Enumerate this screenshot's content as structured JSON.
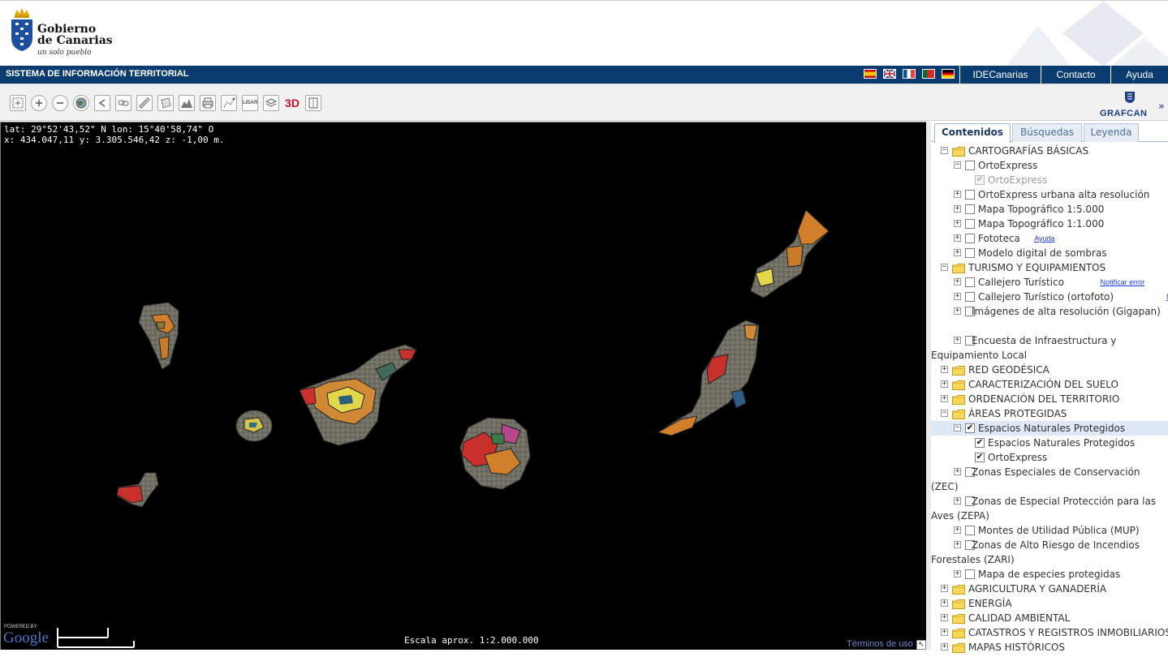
{
  "header": {
    "logo_name_line1": "Gobierno",
    "logo_name_line2": "de Canarias",
    "logo_tagline": "un solo pueblo"
  },
  "navbar": {
    "title": "SISTEMA DE INFORMACIÓN TERRITORIAL",
    "flags": [
      "spanish-flag",
      "english-flag",
      "french-flag",
      "portuguese-flag",
      "german-flag"
    ],
    "links": [
      "IDECanarias",
      "Contacto",
      "Ayuda"
    ]
  },
  "toolbar": {
    "tools": [
      "zoom-box-icon",
      "zoom-in-icon",
      "zoom-out-icon",
      "globe-icon",
      "back-icon",
      "link-icon",
      "ruler-icon",
      "area-measure-icon",
      "profile-icon",
      "print-icon",
      "route-icon",
      "lidar-icon",
      "layers-icon",
      "3d-icon",
      "split-icon"
    ],
    "lidar_label": "LIDAR",
    "three_d_label": "3D",
    "brand": "GRAFCAN",
    "collapse_glyph": "»"
  },
  "map": {
    "coords_line1": "lat: 29°52'43,52\" N  lon: 15°40'58,74\" O",
    "coords_line2": "x: 434.047,11  y: 3.305.546,42  z: -1,00 m.",
    "scale_text": "Escala aprox. 1:2.000.000",
    "terms": "Términos de uso",
    "powered_by": "POWERED BY",
    "google": "Google"
  },
  "panel": {
    "tabs": [
      "Contenidos",
      "Búsquedas",
      "Leyenda"
    ],
    "active_tab": "Contenidos",
    "tree": [
      {
        "level": 0,
        "type": "folder",
        "expanded": true,
        "label": "CARTOGRAFÍAS BÁSICAS"
      },
      {
        "level": 1,
        "type": "layer",
        "expanded": true,
        "checked": false,
        "label": "OrtoExpress"
      },
      {
        "level": 2,
        "type": "sublayer",
        "checked": true,
        "disabled": true,
        "label": "OrtoExpress"
      },
      {
        "level": 1,
        "type": "layer",
        "checked": false,
        "label": "OrtoExpress urbana alta resolución"
      },
      {
        "level": 1,
        "type": "layer",
        "checked": false,
        "label": "Mapa Topográfico 1:5.000"
      },
      {
        "level": 1,
        "type": "layer",
        "checked": false,
        "label": "Mapa Topográfico 1:1.000"
      },
      {
        "level": 1,
        "type": "layer",
        "checked": false,
        "label": "Fototeca",
        "link": "Ayuda"
      },
      {
        "level": 1,
        "type": "layer",
        "checked": false,
        "label": "Modelo digital de sombras"
      },
      {
        "level": 0,
        "type": "folder",
        "expanded": true,
        "label": "TURISMO Y EQUIPAMIENTOS"
      },
      {
        "level": 1,
        "type": "layer",
        "checked": false,
        "label": "Callejero Turístico",
        "link": "Notificar error"
      },
      {
        "level": 1,
        "type": "layer",
        "checked": false,
        "label": "Callejero Turístico (ortofoto)",
        "link": "Notificar error"
      },
      {
        "level": 1,
        "type": "layer",
        "checked": false,
        "label": "Imágenes de alta resolución (Gigapan)"
      },
      {
        "level": 1,
        "type": "layer",
        "checked": false,
        "label": "Encuesta de Infraestructura y Equipamiento Local"
      },
      {
        "level": 0,
        "type": "folder",
        "label": "RED GEODÉSICA"
      },
      {
        "level": 0,
        "type": "folder",
        "label": "CARACTERIZACIÓN DEL SUELO"
      },
      {
        "level": 0,
        "type": "folder",
        "label": "ORDENACIÓN DEL TERRITORIO"
      },
      {
        "level": 0,
        "type": "folder",
        "expanded": true,
        "label": "ÁREAS PROTEGIDAS"
      },
      {
        "level": 1,
        "type": "layer",
        "expanded": true,
        "checked": true,
        "selected": true,
        "label": "Espacios Naturales Protegidos"
      },
      {
        "level": 2,
        "type": "sublayer",
        "checked": true,
        "label": "Espacios Naturales Protegidos"
      },
      {
        "level": 2,
        "type": "sublayer",
        "checked": true,
        "label": "OrtoExpress"
      },
      {
        "level": 1,
        "type": "layer",
        "checked": false,
        "label": "Zonas Especiales de Conservación (ZEC)"
      },
      {
        "level": 1,
        "type": "layer",
        "checked": false,
        "label": "Zonas de Especial Protección para las Aves (ZEPA)"
      },
      {
        "level": 1,
        "type": "layer",
        "checked": false,
        "label": "Montes de Utilidad Pública (MUP)"
      },
      {
        "level": 1,
        "type": "layer",
        "checked": false,
        "label": "Zonas de Alto Riesgo de Incendios Forestales (ZARI)"
      },
      {
        "level": 1,
        "type": "layer",
        "checked": false,
        "label": "Mapa de especies protegidas"
      },
      {
        "level": 0,
        "type": "folder",
        "label": "AGRICULTURA Y GANADERÍA"
      },
      {
        "level": 0,
        "type": "folder",
        "label": "ENERGÍA"
      },
      {
        "level": 0,
        "type": "folder",
        "label": "CALIDAD AMBIENTAL"
      },
      {
        "level": 0,
        "type": "folder",
        "label": "CATASTROS Y REGISTROS INMOBILIARIOS"
      },
      {
        "level": 0,
        "type": "folder",
        "label": "MAPAS HISTÓRICOS"
      }
    ]
  }
}
